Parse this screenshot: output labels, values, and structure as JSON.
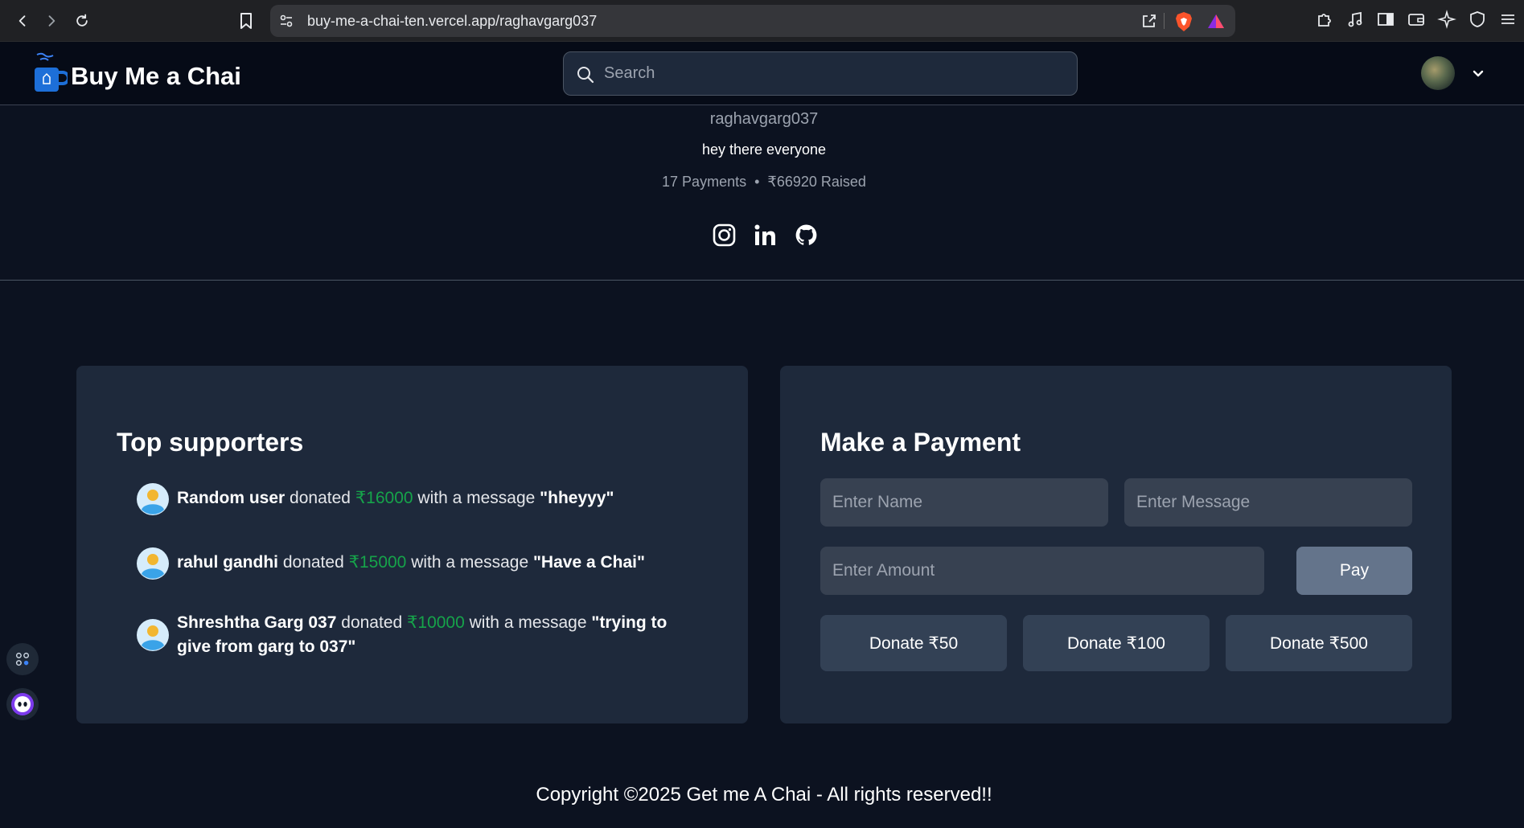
{
  "browser": {
    "url": "buy-me-a-chai-ten.vercel.app/raghavgarg037"
  },
  "header": {
    "logo_text": "Buy Me a Chai",
    "search_placeholder": "Search"
  },
  "profile": {
    "username": "raghavgarg037",
    "description": "hey there everyone",
    "payments": "17 Payments",
    "separator": "•",
    "raised": "₹66920 Raised",
    "socials": [
      "instagram-icon",
      "linkedin-icon",
      "github-icon"
    ]
  },
  "supporters_card": {
    "title": "Top supporters",
    "donated_word": "donated",
    "message_phrase": "with a message",
    "items": [
      {
        "name": "Random user",
        "amount": "₹16000",
        "message": "\"hheyyy\""
      },
      {
        "name": "rahul gandhi",
        "amount": "₹15000",
        "message": "\"Have a Chai\""
      },
      {
        "name": "Shreshtha Garg 037",
        "amount": "₹10000",
        "message": "\"trying to give from garg to 037\""
      }
    ]
  },
  "payment_card": {
    "title": "Make a Payment",
    "name_placeholder": "Enter Name",
    "message_placeholder": "Enter Message",
    "amount_placeholder": "Enter Amount",
    "pay_label": "Pay",
    "donate_options": [
      "Donate ₹50",
      "Donate ₹100",
      "Donate ₹500"
    ]
  },
  "footer": {
    "text": "Copyright ©2025 Get me A Chai - All rights reserved!!"
  },
  "colors": {
    "background": "#0c1220",
    "card": "#1e293b",
    "amount_green": "#16a34a",
    "pay_button": "#64748b"
  }
}
